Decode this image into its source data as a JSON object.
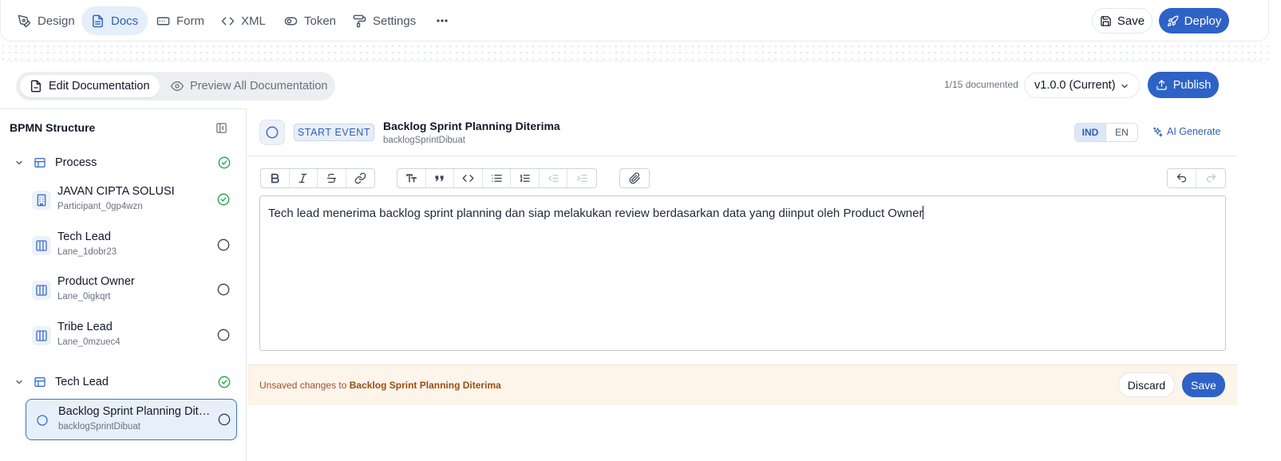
{
  "topbar": {
    "tabs": [
      {
        "label": "Design",
        "icon": "pen-tool-icon"
      },
      {
        "label": "Docs",
        "icon": "document-icon"
      },
      {
        "label": "Form",
        "icon": "form-icon"
      },
      {
        "label": "XML",
        "icon": "code-icon"
      },
      {
        "label": "Token",
        "icon": "toggle-icon"
      },
      {
        "label": "Settings",
        "icon": "paint-roller-icon"
      }
    ],
    "active_tab": "Docs",
    "save_label": "Save",
    "deploy_label": "Deploy"
  },
  "doc_header": {
    "edit_label": "Edit Documentation",
    "preview_label": "Preview All Documentation",
    "documented_count": "1/15 documented",
    "version": "v1.0.0 (Current)",
    "publish_label": "Publish"
  },
  "sidebar": {
    "title": "BPMN Structure",
    "groups": [
      {
        "label": "Process",
        "items": [
          {
            "name": "JAVAN CIPTA SOLUSI",
            "id": "Participant_0gp4wzn",
            "icon": "building-icon",
            "documented": true
          },
          {
            "name": "Tech Lead",
            "id": "Lane_1dobr23",
            "icon": "lane-icon",
            "documented": false
          },
          {
            "name": "Product Owner",
            "id": "Lane_0igkqrt",
            "icon": "lane-icon",
            "documented": false
          },
          {
            "name": "Tribe Lead",
            "id": "Lane_0mzuec4",
            "icon": "lane-icon",
            "documented": false
          }
        ]
      },
      {
        "label": "Tech Lead",
        "items": [
          {
            "name": "Backlog Sprint Planning Diteri...",
            "id": "backlogSprintDibuat",
            "icon": "circle-icon",
            "documented": false
          }
        ]
      }
    ]
  },
  "node": {
    "type": "START EVENT",
    "name": "Backlog Sprint Planning Diterima",
    "id": "backlogSprintDibuat",
    "lang_ind": "IND",
    "lang_en": "EN",
    "ai_generate": "AI Generate"
  },
  "editor": {
    "content": "Tech lead menerima backlog sprint planning dan siap melakukan review berdasarkan data yang diinput oleh Product Owner"
  },
  "unsaved_bar": {
    "prefix": "Unsaved changes to ",
    "target": "Backlog Sprint Planning Diterima",
    "discard_label": "Discard",
    "save_label": "Save"
  },
  "colors": {
    "accent": "#2e62c6",
    "success": "#16a34a",
    "warning_bg": "#fdf4ea"
  }
}
